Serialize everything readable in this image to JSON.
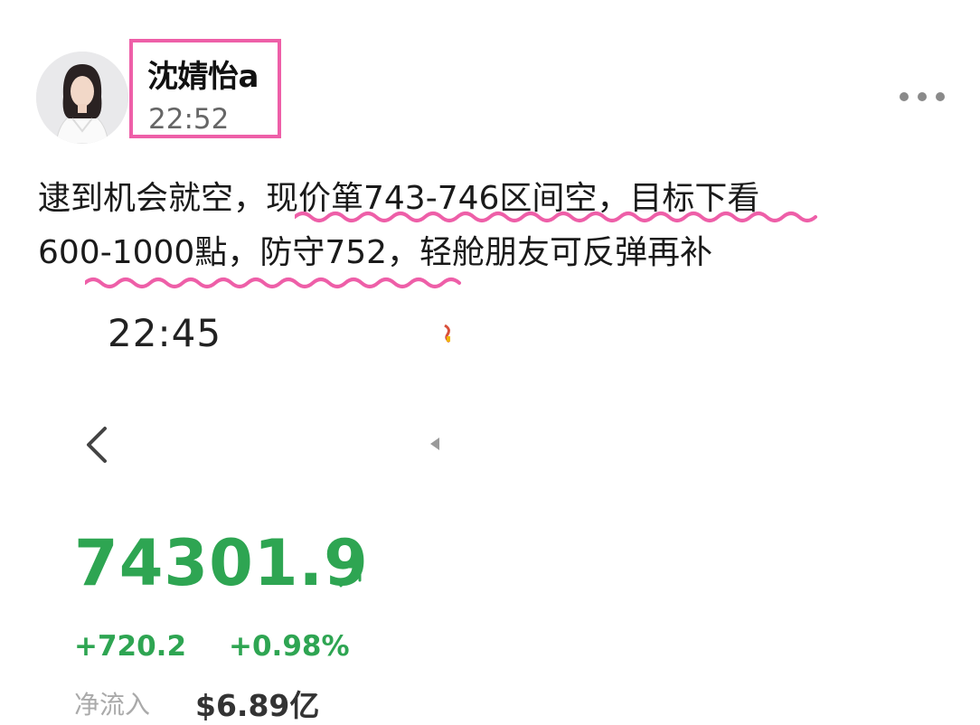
{
  "post": {
    "author_name": "沈婧怡a",
    "post_time": "22:52",
    "text_line1": "逮到机会就空，现价箪743-746区间空，目标下看",
    "text_line2": "600-1000點，防守752，轻舱朋友可反弹再补"
  },
  "screenshot": {
    "status_time": "22:45",
    "index_value": "74301.9",
    "change_points": "+720.2",
    "change_percent": "+0.98%",
    "net_inflow_label": "净流入",
    "net_inflow_value": "$6.89亿"
  },
  "icons": {
    "more": "more-dots-icon",
    "back": "chevron-left-icon",
    "trend": "arrow-up-right-icon"
  },
  "colors": {
    "highlight": "#ee5fa8",
    "gain": "#2ea552"
  }
}
